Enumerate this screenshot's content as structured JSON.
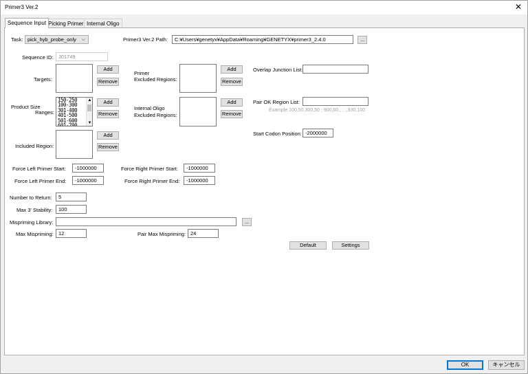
{
  "window": {
    "title": "Primer3 Ver.2"
  },
  "tabs": [
    "Sequence Input",
    "Picking Primer",
    "Internal Oligo"
  ],
  "task": {
    "label": "Task:",
    "value": "pick_hyb_probe_only"
  },
  "path": {
    "label": "Primer3 Ver.2 Path:",
    "value": "C:¥Users¥genetyx¥AppData¥Roaming¥GENETYX¥primer3_2.4.0",
    "browse": "..."
  },
  "sequence_id": {
    "label": "Sequence ID:",
    "value": "J01749"
  },
  "targets": {
    "label": "Targets:",
    "add": "Add",
    "remove": "Remove"
  },
  "primer_excluded": {
    "label_line1": "Primer",
    "label_line2": "Excluded Regions:",
    "add": "Add",
    "remove": "Remove"
  },
  "overlap_junction": {
    "label": "Overlap Junction List:",
    "value": ""
  },
  "product_size": {
    "label_line1": "Product Size",
    "label_line2": "Ranges:",
    "items": [
      "150-250",
      "100-300",
      "301-400",
      "401-500",
      "501-600",
      "601-700"
    ],
    "add": "Add",
    "remove": "Remove"
  },
  "internal_oligo_excluded": {
    "label_line1": "Internal Oligo",
    "label_line2": "Excluded Regions:",
    "add": "Add",
    "remove": "Remove"
  },
  "pair_ok": {
    "label": "Pair OK Region List:",
    "value": "",
    "hint": "Example 100,50,300,50 ; 900,60,, ; ,,930,100"
  },
  "included_region": {
    "label": "Included Region:",
    "add": "Add",
    "remove": "Remove"
  },
  "start_codon": {
    "label": "Start Codon Position:",
    "value": "-2000000"
  },
  "force_left_start": {
    "label": "Force Left Primer Start:",
    "value": "-1000000"
  },
  "force_right_start": {
    "label": "Force Right Primer Start:",
    "value": "-1000000"
  },
  "force_left_end": {
    "label": "Force Left Primer End:",
    "value": "-1000000"
  },
  "force_right_end": {
    "label": "Force Right Primer End:",
    "value": "-1000000"
  },
  "number_to_return": {
    "label": "Number to Return:",
    "value": "5"
  },
  "max_3_stability": {
    "label": "Max 3' Stability:",
    "value": "100"
  },
  "mispriming_library": {
    "label": "Mispriming Library:",
    "value": "",
    "browse": "..."
  },
  "max_mispriming": {
    "label": "Max Mispriming:",
    "value": "12"
  },
  "pair_max_mispriming": {
    "label": "Pair Max Mispriming:",
    "value": "24"
  },
  "actions": {
    "default": "Default",
    "settings": "Settings"
  },
  "footer": {
    "ok": "OK",
    "cancel": "キャンセル"
  }
}
